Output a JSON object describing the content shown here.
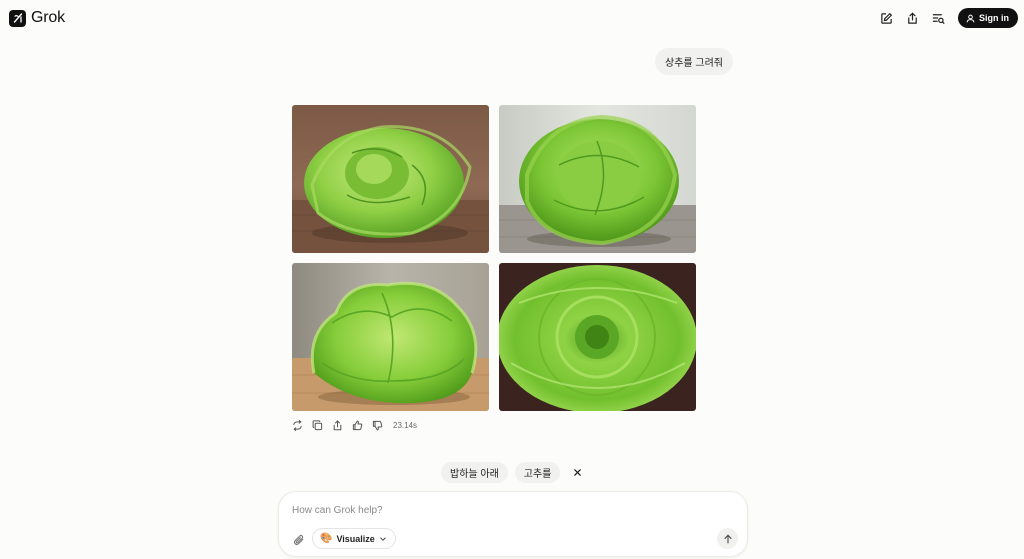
{
  "app": {
    "name": "Grok"
  },
  "header": {
    "new_chat_icon": "edit-icon",
    "share_icon": "share-icon",
    "history_icon": "history-search-icon",
    "signin_label": "Sign in"
  },
  "conversation": {
    "user_message": "상추를 그려줘",
    "images": [
      {
        "description_icon": "lettuce-image-1"
      },
      {
        "description_icon": "lettuce-image-2"
      },
      {
        "description_icon": "lettuce-image-3"
      },
      {
        "description_icon": "lettuce-image-4"
      }
    ],
    "actions": {
      "regenerate_icon": "regenerate-icon",
      "copy_icon": "copy-icon",
      "share_icon": "share-icon",
      "like_icon": "thumbs-up-icon",
      "dislike_icon": "thumbs-down-icon",
      "elapsed": "23.14s"
    }
  },
  "suggestions": {
    "items": [
      "밥하늘 아래",
      "고추를"
    ],
    "close_icon": "close-icon"
  },
  "composer": {
    "placeholder": "How can Grok help?",
    "mode_label": "Visualize",
    "mode_emoji": "🎨",
    "attach_icon": "paperclip-icon",
    "send_icon": "arrow-up-icon"
  },
  "colors": {
    "background": "#fcfcfb",
    "bubble": "#f1f1ef",
    "primary": "#111111",
    "lettuce_light": "#a8dc5c",
    "lettuce_dark": "#4f9a1e"
  }
}
